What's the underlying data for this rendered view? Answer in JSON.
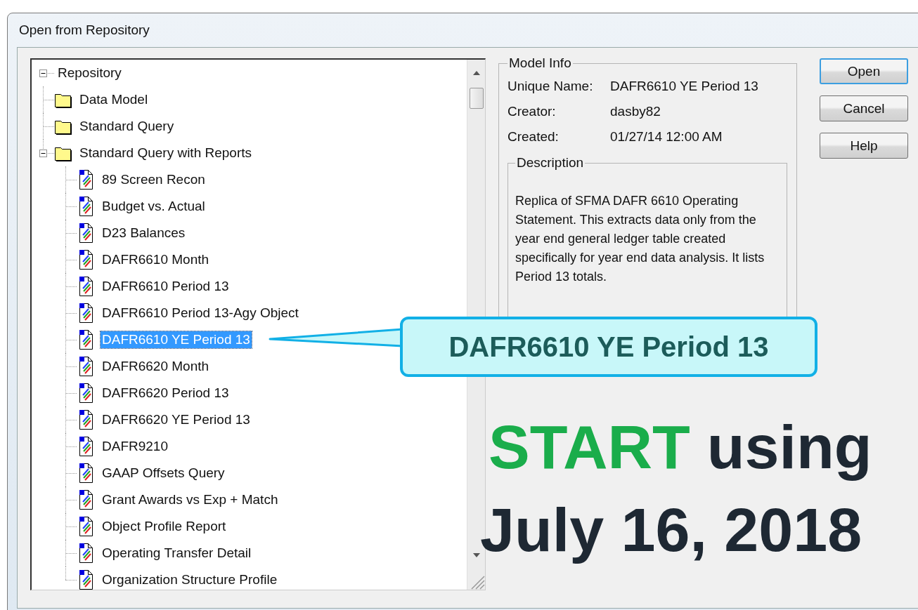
{
  "window": {
    "title": "Open from Repository"
  },
  "tree": {
    "label": "Repository",
    "kind": "root",
    "expanded": true,
    "selected": false,
    "children": [
      {
        "label": "Data Model",
        "kind": "folder",
        "selected": false
      },
      {
        "label": "Standard Query",
        "kind": "folder",
        "selected": false
      },
      {
        "label": "Standard Query with Reports",
        "kind": "folder",
        "expanded": true,
        "selected": false,
        "children": [
          {
            "label": "89 Screen Recon",
            "kind": "report",
            "selected": false
          },
          {
            "label": "Budget vs. Actual",
            "kind": "report",
            "selected": false
          },
          {
            "label": "D23 Balances",
            "kind": "report",
            "selected": false
          },
          {
            "label": "DAFR6610 Month",
            "kind": "report",
            "selected": false
          },
          {
            "label": "DAFR6610 Period 13",
            "kind": "report",
            "selected": false
          },
          {
            "label": "DAFR6610 Period 13-Agy Object",
            "kind": "report",
            "selected": false
          },
          {
            "label": "DAFR6610 YE Period 13",
            "kind": "report",
            "selected": true
          },
          {
            "label": "DAFR6620 Month",
            "kind": "report",
            "selected": false
          },
          {
            "label": "DAFR6620 Period 13",
            "kind": "report",
            "selected": false
          },
          {
            "label": "DAFR6620 YE Period 13",
            "kind": "report",
            "selected": false
          },
          {
            "label": "DAFR9210",
            "kind": "report",
            "selected": false
          },
          {
            "label": "GAAP Offsets Query",
            "kind": "report",
            "selected": false
          },
          {
            "label": "Grant Awards vs Exp + Match",
            "kind": "report",
            "selected": false
          },
          {
            "label": "Object Profile Report",
            "kind": "report",
            "selected": false
          },
          {
            "label": "Operating Transfer Detail",
            "kind": "report",
            "selected": false
          },
          {
            "label": "Organization Structure Profile",
            "kind": "report",
            "selected": false
          }
        ]
      }
    ]
  },
  "model_info": {
    "title": "Model Info",
    "fields": [
      {
        "label": "Unique Name:",
        "value": "DAFR6610 YE Period 13"
      },
      {
        "label": "Creator:",
        "value": "dasby82"
      },
      {
        "label": "Created:",
        "value": "01/27/14 12:00 AM"
      }
    ],
    "description": {
      "title": "Description",
      "text": "Replica of SFMA DAFR 6610 Operating Statement. This extracts data only from the year end general ledger table created specifically for year end data analysis. It lists Period 13 totals."
    }
  },
  "buttons": [
    {
      "label": "Open",
      "default": true
    },
    {
      "label": "Cancel",
      "default": false
    },
    {
      "label": "Help",
      "default": false
    }
  ],
  "callout": {
    "text": "DAFR6610 YE Period 13"
  },
  "headline": {
    "parts": [
      {
        "text": "START",
        "color": "#1aad4b"
      },
      {
        "text": "using",
        "color": "#1e2833"
      }
    ]
  },
  "date_line": "July 16, 2018"
}
